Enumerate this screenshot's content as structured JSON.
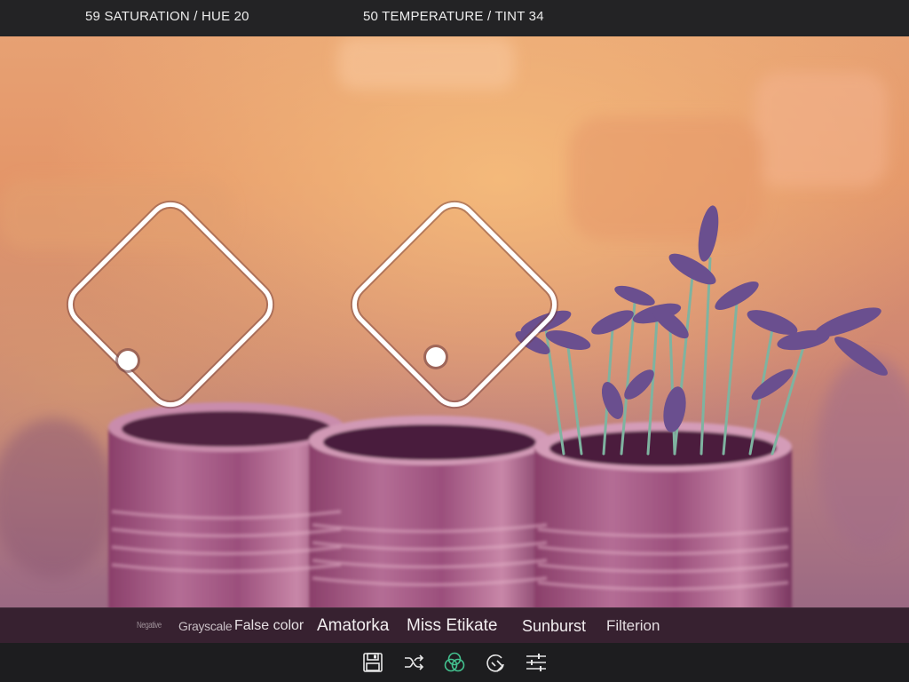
{
  "top_bar": {
    "saturation_hue_readout": "59 SATURATION / HUE 20",
    "temperature_tint_readout": "50 TEMPERATURE / TINT 34"
  },
  "adjustments": {
    "saturation": 59,
    "hue": 20,
    "temperature": 50,
    "tint": 34
  },
  "filters": [
    {
      "label": "Negative"
    },
    {
      "label": "Grayscale"
    },
    {
      "label": "False color"
    },
    {
      "label": "Amatorka"
    },
    {
      "label": "Miss Etikate"
    },
    {
      "label": "Sunburst"
    },
    {
      "label": "Filterion"
    }
  ],
  "toolbar": {
    "icons": [
      "save-icon",
      "shuffle-icon",
      "color-filter-icon",
      "undo-icon",
      "sliders-icon"
    ],
    "active_icon": "color-filter-icon",
    "active_color": "#43c28f",
    "icon_color": "#e8e8e8"
  },
  "colors": {
    "top_bar": "#232325",
    "filter_strip": "#3a2232",
    "toolbar": "#1d1d1f",
    "pad_stroke": "#ffffff"
  }
}
